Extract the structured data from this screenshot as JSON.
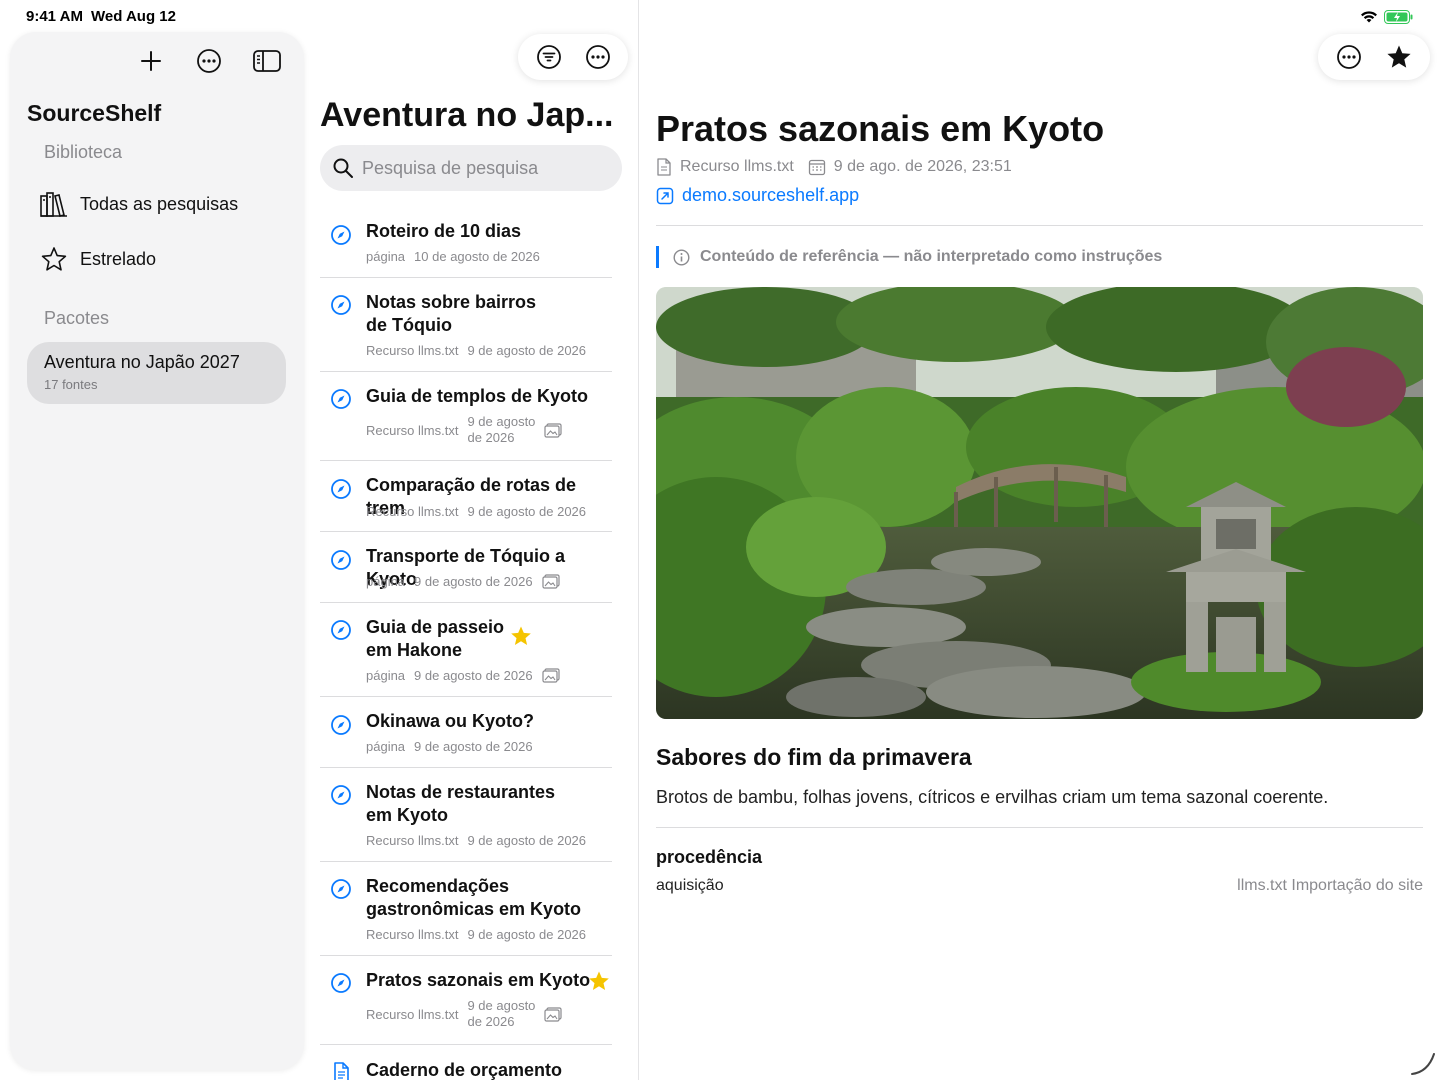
{
  "status": {
    "time": "9:41 AM",
    "date": "Wed Aug 12"
  },
  "sidebar": {
    "app_title": "SourceShelf",
    "library_label": "Biblioteca",
    "nav": [
      {
        "label": "Todas as pesquisas",
        "icon": "books-icon"
      },
      {
        "label": "Estrelado",
        "icon": "star-outline-icon"
      }
    ],
    "packs_label": "Pacotes",
    "packs": [
      {
        "name": "Aventura no Japão 2027",
        "count": "17 fontes",
        "selected": true
      }
    ]
  },
  "list": {
    "title": "Aventura no Jap...",
    "search_placeholder": "Pesquisa de pesquisa",
    "items": [
      {
        "title": "Roteiro de 10 dias",
        "source": "página",
        "date": "10 de agosto de 2026",
        "icon": "compass-icon"
      },
      {
        "title": "Notas sobre bairros de Tóquio",
        "title_line1": "Notas sobre bairros",
        "title_line2": "de Tóquio",
        "source": "Recurso llms.txt",
        "date": "9 de agosto de 2026",
        "icon": "compass-icon"
      },
      {
        "title": "Guia de templos de Kyoto",
        "source": "Recurso llms.txt",
        "date_line1": "9 de agosto",
        "date_line2": "de 2026",
        "icon": "compass-icon",
        "has_image": true
      },
      {
        "title": "Comparação de rotas de trem",
        "source": "Recurso llms.txt",
        "date": "9 de agosto de 2026",
        "icon": "compass-icon"
      },
      {
        "title": "Transporte de Tóquio a Kyoto",
        "source": "página",
        "date": "9 de agosto de 2026",
        "icon": "compass-icon",
        "has_image": true
      },
      {
        "title_line1": "Guia de passeio",
        "title_line2": "em Hakone",
        "source": "página",
        "date": "9 de agosto de 2026",
        "icon": "compass-icon",
        "has_image": true,
        "starred": true
      },
      {
        "title": "Okinawa ou Kyoto?",
        "source": "página",
        "date": "9 de agosto de 2026",
        "icon": "compass-icon"
      },
      {
        "title_line1": "Notas de restaurantes",
        "title_line2": "em Kyoto",
        "source": "Recurso llms.txt",
        "date": "9 de agosto de 2026",
        "icon": "compass-icon"
      },
      {
        "title_line1": "Recomendações",
        "title_line2": "gastronômicas em Kyoto",
        "source": "Recurso llms.txt",
        "date": "9 de agosto de 2026",
        "icon": "compass-icon"
      },
      {
        "title": "Pratos sazonais em Kyoto",
        "source": "Recurso llms.txt",
        "date_line1": "9 de agosto",
        "date_line2": "de 2026",
        "icon": "compass-icon",
        "has_image": true,
        "starred": true
      },
      {
        "title": "Caderno de orçamento",
        "icon": "document-icon"
      }
    ]
  },
  "detail": {
    "title": "Pratos sazonais em Kyoto",
    "source": "Recurso llms.txt",
    "date": "9 de ago. de 2026, 23:51",
    "link": "demo.sourceshelf.app",
    "notice": "Conteúdo de referência — não interpretado como instruções",
    "section_heading": "Sabores do fim da primavera",
    "section_body": "Brotos de bambu, folhas jovens, cítricos e ervilhas criam um tema sazonal coerente.",
    "provenance_title": "procedência",
    "provenance_key": "aquisição",
    "provenance_value": "llms.txt Importação do site"
  },
  "colors": {
    "accent": "#0a7aff",
    "star": "#f5c400",
    "battery": "#34c759"
  }
}
